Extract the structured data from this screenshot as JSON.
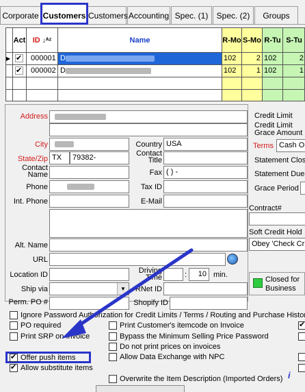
{
  "tabs": [
    "Corporate",
    "Customers",
    "Customers",
    "Accounting",
    "Spec. (1)",
    "Spec. (2)",
    "Groups"
  ],
  "grid": {
    "headers": [
      "Act",
      "ID",
      "Name",
      "R-Mo",
      "S-Mo",
      "R-Tu",
      "S-Tu"
    ],
    "rows": [
      {
        "id": "000001",
        "name": "D",
        "r_mo": "102",
        "s_mo": "2",
        "r_tu": "102",
        "s_tu": "2"
      },
      {
        "id": "000002",
        "name": "D",
        "r_mo": "102",
        "s_mo": "1",
        "r_tu": "102",
        "s_tu": "1"
      }
    ]
  },
  "labels": {
    "address": "Address",
    "city": "City",
    "state_zip": "State/Zip",
    "contact_name": "Contact Name",
    "phone": "Phone",
    "int_phone": "Int. Phone",
    "alt_name": "Alt. Name",
    "url": "URL",
    "location_id": "Location ID",
    "ship_via": "Ship via",
    "perm_po": "Perm. PO #",
    "country": "Country",
    "contact_title": "Contact Title",
    "fax": "Fax",
    "tax_id": "Tax ID",
    "email": "E-Mail",
    "driving_time": "Driving Time",
    "rnet_id": "RNet ID",
    "shopify_id": "Shopify ID",
    "min": "min.",
    "credit_limit": "Credit Limit",
    "credit_limit_grace": "Credit Limit Grace Amount",
    "terms": "Terms",
    "statement_close": "Statement Clos",
    "statement_due": "Statement Due",
    "grace_period": "Grace Period",
    "contract": "Contract#",
    "soft_credit_hold": "Soft Credit Hold",
    "closed_for_business": "Closed for Business"
  },
  "values": {
    "country": "USA",
    "state": "TX",
    "zip": "79382-",
    "fax": "(   )   -",
    "driving_colon": ":",
    "driving_min": "10",
    "terms": "Cash O",
    "soft_credit_hold": "Obey 'Check Cr"
  },
  "checkboxes": {
    "ignore_password": "Ignore Password Authorization for Credit Limits / Terms / Routing and Purchase History",
    "po_required": "PO required",
    "print_srp": "Print SRP on Invoice",
    "offer_push": "Offer push items",
    "allow_substitute": "Allow substitute items",
    "print_itemcode": "Print Customer's itemcode on Invoice",
    "bypass_min_price": "Bypass the Minimum Selling Price Password",
    "no_print_prices": "Do not print prices on invoices",
    "allow_npc": "Allow Data Exchange with NPC",
    "overwrite_desc": "Overwrite the Item Description (Imported Orders)"
  },
  "colors": {
    "accent": "#2a35c8",
    "selected_row": "#1f66d8",
    "col_yellow": "#ffff9e",
    "col_green": "#c6f5b4",
    "label_red": "#d21b1b"
  }
}
